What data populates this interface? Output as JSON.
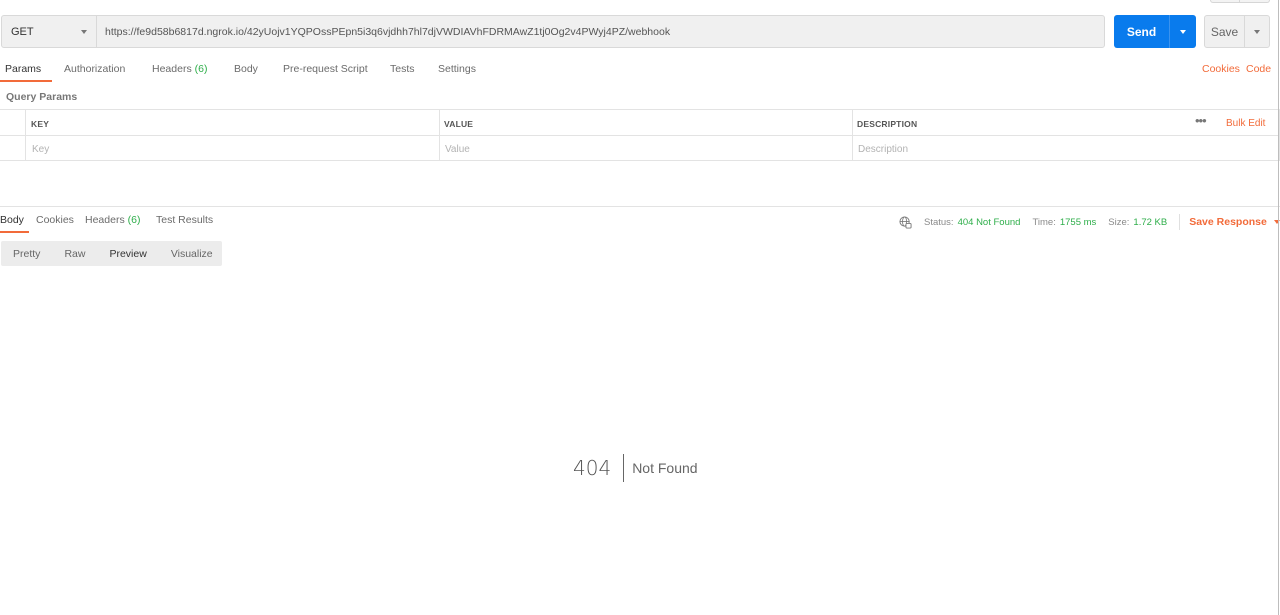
{
  "request": {
    "method": "GET",
    "url": "https://fe9d58b6817d.ngrok.io/42yUojv1YQPOssPEpn5i3q6vjdhh7hl7djVWDIAVhFDRMAwZ1tj0Og2v4PWyj4PZ/webhook",
    "send_label": "Send",
    "save_label": "Save"
  },
  "request_tabs": [
    {
      "label": "Params",
      "active": true
    },
    {
      "label": "Authorization"
    },
    {
      "label": "Headers",
      "count": "(6)"
    },
    {
      "label": "Body"
    },
    {
      "label": "Pre-request Script"
    },
    {
      "label": "Tests"
    },
    {
      "label": "Settings"
    }
  ],
  "right_links": {
    "cookies": "Cookies",
    "code": "Code"
  },
  "query_params": {
    "title": "Query Params",
    "headers": {
      "key": "KEY",
      "value": "VALUE",
      "description": "DESCRIPTION"
    },
    "placeholders": {
      "key": "Key",
      "value": "Value",
      "description": "Description"
    },
    "more": "•••",
    "bulk_edit": "Bulk Edit"
  },
  "response_tabs": [
    {
      "label": "Body",
      "active": true
    },
    {
      "label": "Cookies"
    },
    {
      "label": "Headers",
      "count": "(6)"
    },
    {
      "label": "Test Results"
    }
  ],
  "response_meta": {
    "status_label": "Status:",
    "status_value": "404 Not Found",
    "time_label": "Time:",
    "time_value": "1755 ms",
    "size_label": "Size:",
    "size_value": "1.72 KB",
    "save_response": "Save Response"
  },
  "view_modes": [
    "Pretty",
    "Raw",
    "Preview",
    "Visualize"
  ],
  "preview": {
    "code": "404",
    "message": "Not Found"
  },
  "colors": {
    "accent": "#f26b3a",
    "primary": "#097bed",
    "success": "#2eae4a"
  },
  "icons": [
    "caret-down-icon",
    "globe-icon",
    "more-icon"
  ]
}
